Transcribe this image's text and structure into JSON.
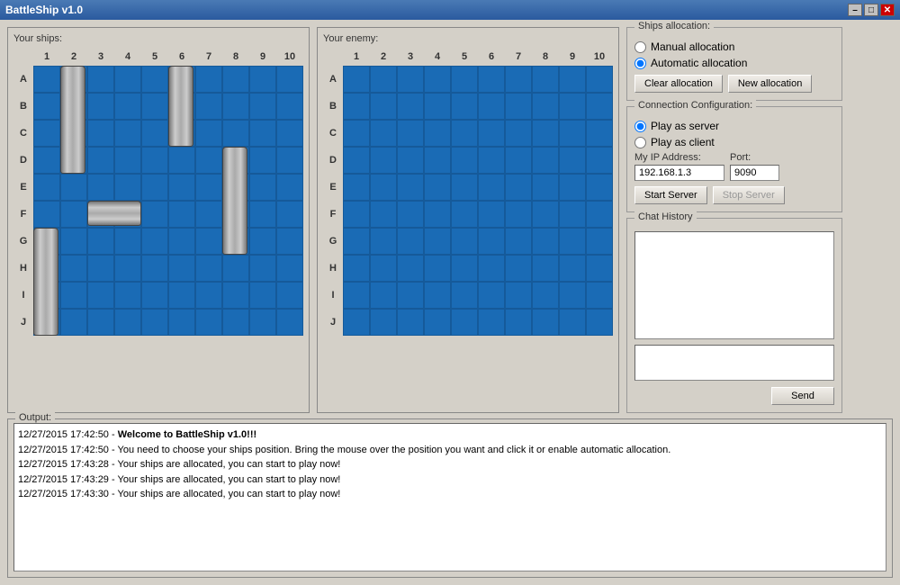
{
  "window": {
    "title": "BattleShip v1.0",
    "min_label": "–",
    "max_label": "□",
    "close_label": "✕"
  },
  "your_ships": {
    "title": "Your ships:",
    "col_headers": [
      "1",
      "2",
      "3",
      "4",
      "5",
      "6",
      "7",
      "8",
      "9",
      "10"
    ],
    "row_headers": [
      "A",
      "B",
      "C",
      "D",
      "E",
      "F",
      "G",
      "H",
      "I",
      "J"
    ]
  },
  "your_enemy": {
    "title": "Your enemy:",
    "col_headers": [
      "1",
      "2",
      "3",
      "4",
      "5",
      "6",
      "7",
      "8",
      "9",
      "10"
    ],
    "row_headers": [
      "A",
      "B",
      "C",
      "D",
      "E",
      "F",
      "G",
      "H",
      "I",
      "J"
    ]
  },
  "ships_allocation": {
    "title": "Ships allocation:",
    "manual_label": "Manual allocation",
    "automatic_label": "Automatic allocation",
    "clear_label": "Clear allocation",
    "new_label": "New allocation",
    "automatic_selected": true
  },
  "connection": {
    "title": "Connection Configuration:",
    "server_label": "Play as server",
    "client_label": "Play as client",
    "server_selected": true,
    "ip_label": "My IP Address:",
    "port_label": "Port:",
    "ip_value": "192.168.1.3",
    "port_value": "9090",
    "start_label": "Start Server",
    "stop_label": "Stop Server"
  },
  "chat": {
    "title": "Chat History",
    "send_label": "Send"
  },
  "output": {
    "title": "Output:",
    "lines": [
      {
        "text": "12/27/2015 17:42:50 - ",
        "bold": false
      },
      {
        "text": "Welcome to BattleShip v1.0!!!",
        "bold": true
      },
      {
        "text": "\n12/27/2015 17:42:50 - You need to choose your ships position. Bring the mouse over the position you want and click it or enable automatic allocation.\n12/27/2015 17:43:28 - Your ships are allocated, you can start to play now!\n12/27/2015 17:43:29 - Your ships are allocated, you can start to play now!\n12/27/2015 17:43:30 - Your ships are allocated, you can start to play now!",
        "bold": false
      }
    ]
  }
}
